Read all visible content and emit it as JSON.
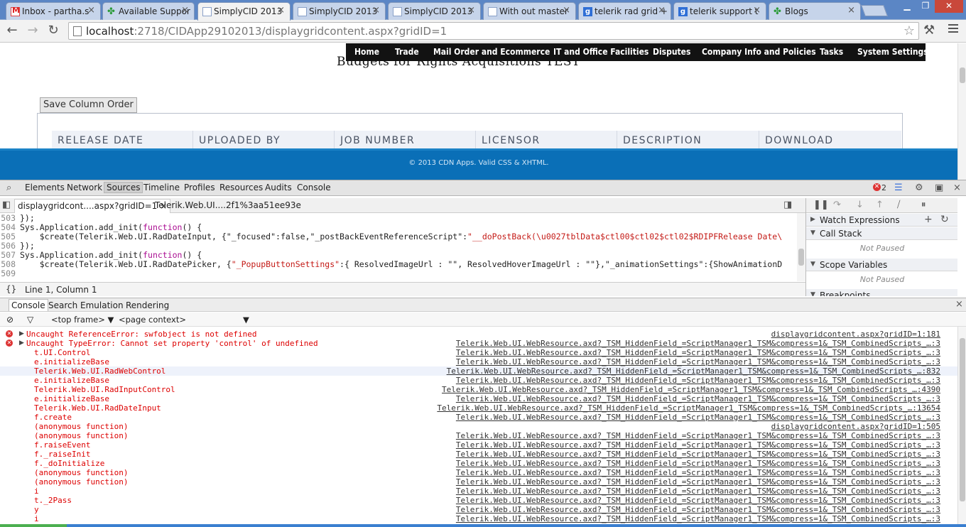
{
  "browser": {
    "tabs": [
      {
        "label": "Inbox - partha.s",
        "icon": "gmail-icon",
        "active": false
      },
      {
        "label": "Available Suppor",
        "icon": "clover-icon",
        "active": false
      },
      {
        "label": "SimplyCID 2013",
        "icon": "document-icon",
        "active": true
      },
      {
        "label": "SimplyCID 2013",
        "icon": "document-icon",
        "active": false
      },
      {
        "label": "SimplyCID 2013",
        "icon": "document-icon",
        "active": false
      },
      {
        "label": "With out master",
        "icon": "document-icon",
        "active": false
      },
      {
        "label": "telerik rad grid +",
        "icon": "google-icon",
        "active": false
      },
      {
        "label": "telerik support t",
        "icon": "google-icon",
        "active": false
      },
      {
        "label": "Blogs",
        "icon": "clover-icon",
        "active": false
      }
    ],
    "address": {
      "host": "localhost",
      "rest": ":2718/CIDApp29102013/displaygridcontent.aspx?gridID=1"
    }
  },
  "page": {
    "title": "Budgets for Rights Acquisitions TEST",
    "nav": [
      "Home",
      "Trade",
      "Mail Order and Ecommerce",
      "IT and Office Facilities",
      "Disputes",
      "Company Info and Policies",
      "Tasks",
      "System Settings"
    ],
    "save_button": "Save Column Order",
    "columns": [
      "RELEASE DATE",
      "UPLOADED BY",
      "JOB NUMBER",
      "LICENSOR",
      "DESCRIPTION",
      "DOWNLOAD"
    ],
    "footer": "© 2013 CDN Apps. Valid CSS & XHTML."
  },
  "devtools": {
    "tabs": [
      "Elements",
      "Network",
      "Sources",
      "Timeline",
      "Profiles",
      "Resources",
      "Audits",
      "Console"
    ],
    "active_tab": "Sources",
    "error_count": "2",
    "source_tabs": [
      "displaygridcont....aspx?gridID=1",
      "Telerik.Web.UI....2f1%3aa51ee93e"
    ],
    "code": [
      {
        "num": "503",
        "text": "});"
      },
      {
        "num": "504",
        "pre": "Sys.Application.add_init(",
        "kw": "function",
        "post": "() {"
      },
      {
        "num": "505",
        "pre": "    $create(Telerik.Web.UI.RadDateInput, {\"_focused\":false,\"_postBackEventReferenceScript\":",
        "str": "\"__doPostBack(\\u0027tblData$ctl00$ctl02$ctl02$RDIPFRelease Date\\"
      },
      {
        "num": "506",
        "text": "});"
      },
      {
        "num": "507",
        "pre": "Sys.Application.add_init(",
        "kw": "function",
        "post": "() {"
      },
      {
        "num": "508",
        "pre": "    $create(Telerik.Web.UI.RadDatePicker, {",
        "str": "\"_PopupButtonSettings\"",
        "post": ":{ ResolvedImageUrl : \"\", ResolvedHoverImageUrl : \"\"},\"_animationSettings\":{ShowAnimationD"
      },
      {
        "num": "509",
        "text": ""
      }
    ],
    "cursor_position": "Line 1, Column 1",
    "sidebar": {
      "watch": "Watch Expressions",
      "callstack": "Call Stack",
      "scope": "Scope Variables",
      "breakpoints": "Breakpoints",
      "not_paused": "Not Paused"
    },
    "drawer_tabs": [
      "Console",
      "Search",
      "Emulation",
      "Rendering"
    ],
    "frame_selector": "<top frame>",
    "context_selector": "<page context>",
    "console": [
      {
        "msg": "Uncaught ReferenceError: swfobject is not defined",
        "src": "displaygridcontent.aspx?gridID=1:181",
        "head": true
      },
      {
        "msg": "Uncaught TypeError: Cannot set property 'control' of undefined",
        "src": "Telerik.Web.UI.WebResource.axd?_TSM_HiddenField_=ScriptManager1_TSM&compress=1&_TSM_CombinedScripts_…:3",
        "head": true
      },
      {
        "msg": "t.UI.Control",
        "src": "Telerik.Web.UI.WebResource.axd?_TSM_HiddenField_=ScriptManager1_TSM&compress=1&_TSM_CombinedScripts_…:3"
      },
      {
        "msg": "e.initializeBase",
        "src": "Telerik.Web.UI.WebResource.axd?_TSM_HiddenField_=ScriptManager1_TSM&compress=1&_TSM_CombinedScripts_…:3"
      },
      {
        "msg": "Telerik.Web.UI.RadWebControl",
        "src": "Telerik.Web.UI.WebResource.axd?_TSM_HiddenField_=ScriptManager1_TSM&compress=1&_TSM_CombinedScripts_…:832",
        "highlight": true
      },
      {
        "msg": "e.initializeBase",
        "src": "Telerik.Web.UI.WebResource.axd?_TSM_HiddenField_=ScriptManager1_TSM&compress=1&_TSM_CombinedScripts_…:3"
      },
      {
        "msg": "Telerik.Web.UI.RadInputControl",
        "src": "Telerik.Web.UI.WebResource.axd?_TSM_HiddenField_=ScriptManager1_TSM&compress=1&_TSM_CombinedScripts_…:4390"
      },
      {
        "msg": "e.initializeBase",
        "src": "Telerik.Web.UI.WebResource.axd?_TSM_HiddenField_=ScriptManager1_TSM&compress=1&_TSM_CombinedScripts_…:3"
      },
      {
        "msg": "Telerik.Web.UI.RadDateInput",
        "src": "Telerik.Web.UI.WebResource.axd?_TSM_HiddenField_=ScriptManager1_TSM&compress=1&_TSM_CombinedScripts_…:13654"
      },
      {
        "msg": "f.create",
        "src": "Telerik.Web.UI.WebResource.axd?_TSM_HiddenField_=ScriptManager1_TSM&compress=1&_TSM_CombinedScripts_…:3"
      },
      {
        "msg": "(anonymous function)",
        "src": "displaygridcontent.aspx?gridID=1:505"
      },
      {
        "msg": "(anonymous function)",
        "src": "Telerik.Web.UI.WebResource.axd?_TSM_HiddenField_=ScriptManager1_TSM&compress=1&_TSM_CombinedScripts_…:3"
      },
      {
        "msg": "f.raiseEvent",
        "src": "Telerik.Web.UI.WebResource.axd?_TSM_HiddenField_=ScriptManager1_TSM&compress=1&_TSM_CombinedScripts_…:3"
      },
      {
        "msg": "f._raiseInit",
        "src": "Telerik.Web.UI.WebResource.axd?_TSM_HiddenField_=ScriptManager1_TSM&compress=1&_TSM_CombinedScripts_…:3"
      },
      {
        "msg": "f._doInitialize",
        "src": "Telerik.Web.UI.WebResource.axd?_TSM_HiddenField_=ScriptManager1_TSM&compress=1&_TSM_CombinedScripts_…:3"
      },
      {
        "msg": "(anonymous function)",
        "src": "Telerik.Web.UI.WebResource.axd?_TSM_HiddenField_=ScriptManager1_TSM&compress=1&_TSM_CombinedScripts_…:3"
      },
      {
        "msg": "(anonymous function)",
        "src": "Telerik.Web.UI.WebResource.axd?_TSM_HiddenField_=ScriptManager1_TSM&compress=1&_TSM_CombinedScripts_…:3"
      },
      {
        "msg": "i",
        "src": "Telerik.Web.UI.WebResource.axd?_TSM_HiddenField_=ScriptManager1_TSM&compress=1&_TSM_CombinedScripts_…:3"
      },
      {
        "msg": "t._2Pass",
        "src": "Telerik.Web.UI.WebResource.axd?_TSM_HiddenField_=ScriptManager1_TSM&compress=1&_TSM_CombinedScripts_…:3"
      },
      {
        "msg": "y",
        "src": "Telerik.Web.UI.WebResource.axd?_TSM_HiddenField_=ScriptManager1_TSM&compress=1&_TSM_CombinedScripts_…:3"
      },
      {
        "msg": "i",
        "src": "Telerik.Web.UI.WebResource.axd?_TSM_HiddenField_=ScriptManager1_TSM&compress=1&_TSM_CombinedScripts_…:3"
      }
    ]
  },
  "colors": {
    "footer": "#0a6fb7",
    "nav_bar": "#121212",
    "error_text": "#d00"
  }
}
